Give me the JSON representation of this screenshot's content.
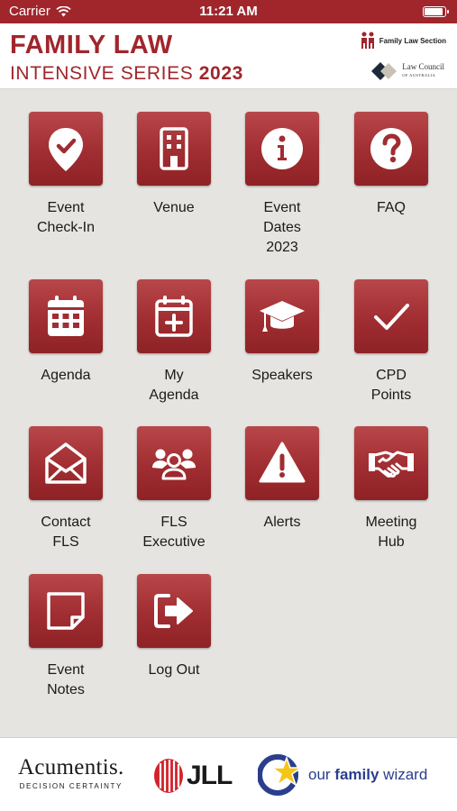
{
  "status_bar": {
    "carrier": "Carrier",
    "time": "11:21 AM",
    "wifi_icon": "wifi-icon",
    "battery_icon": "battery-icon"
  },
  "header": {
    "title_line1": "FAMILY LAW",
    "title_line2_text": "INTENSIVE SERIES ",
    "title_line2_year": "2023",
    "logo_fls": "Family Law Section",
    "logo_lc": "Law Council",
    "logo_lc_sub": "OF AUSTRALIA"
  },
  "menu": [
    {
      "label": "Event\nCheck-In",
      "icon": "location-check-icon"
    },
    {
      "label": "Venue",
      "icon": "building-icon"
    },
    {
      "label": "Event\nDates\n2023",
      "icon": "info-icon"
    },
    {
      "label": "FAQ",
      "icon": "question-icon"
    },
    {
      "label": "Agenda",
      "icon": "calendar-icon"
    },
    {
      "label": "My\nAgenda",
      "icon": "calendar-plus-icon"
    },
    {
      "label": "Speakers",
      "icon": "graduation-cap-icon"
    },
    {
      "label": "CPD\nPoints",
      "icon": "checkmark-icon"
    },
    {
      "label": "Contact\nFLS",
      "icon": "envelope-icon"
    },
    {
      "label": "FLS\nExecutive",
      "icon": "users-icon"
    },
    {
      "label": "Alerts",
      "icon": "warning-icon"
    },
    {
      "label": "Meeting\nHub",
      "icon": "handshake-icon"
    },
    {
      "label": "Event\nNotes",
      "icon": "note-icon"
    },
    {
      "label": "Log Out",
      "icon": "logout-icon"
    }
  ],
  "sponsors": {
    "acumentis": "Acumentis.",
    "acumentis_tagline": "DECISION CERTAINTY",
    "jll": "JLL",
    "ofw_prefix": "our ",
    "ofw_bold": "family",
    "ofw_suffix": " wizard"
  },
  "colors": {
    "brand": "#a0262c",
    "background": "#e6e4e0",
    "ofw_blue": "#2a3e8c"
  }
}
